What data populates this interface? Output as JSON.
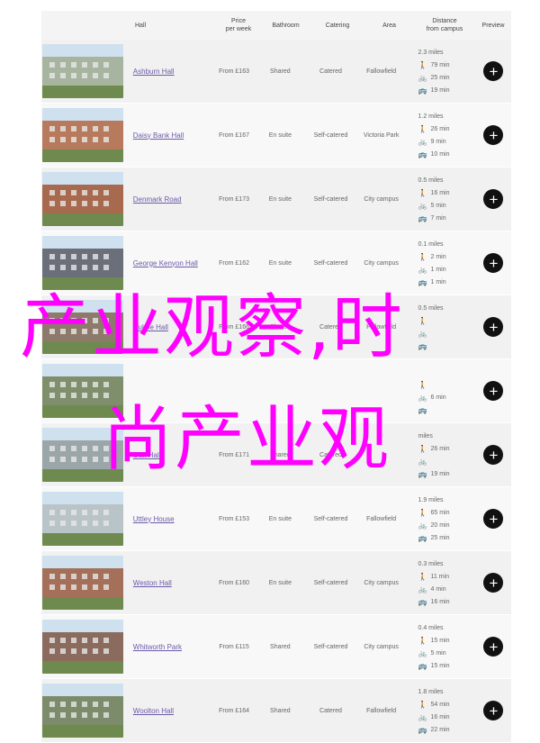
{
  "header": {
    "hall": "Hall",
    "price": "Price\nper week",
    "bathroom": "Bathroom",
    "catering": "Catering",
    "area": "Area",
    "distance": "Distance\nfrom campus",
    "preview": "Preview"
  },
  "rows": [
    {
      "name": "Ashburn Hall",
      "price": "From £163",
      "bath": "Shared",
      "cat": "Catered",
      "area": "Fallowfield",
      "miles": "2.3 miles",
      "walk": "79 min",
      "cycle": "25 min",
      "bus": "19 min",
      "thumb": "#a7b5a0"
    },
    {
      "name": "Daisy Bank Hall",
      "price": "From £167",
      "bath": "En suite",
      "cat": "Self-catered",
      "area": "Victoria Park",
      "miles": "1.2 miles",
      "walk": "26 min",
      "cycle": "9 min",
      "bus": "10 min",
      "thumb": "#b77a5c"
    },
    {
      "name": "Denmark Road",
      "price": "From £173",
      "bath": "En suite",
      "cat": "Self-catered",
      "area": "City campus",
      "miles": "0.5 miles",
      "walk": "16 min",
      "cycle": "5 min",
      "bus": "7 min",
      "thumb": "#a86a4e"
    },
    {
      "name": "George Kenyon Hall",
      "price": "From £162",
      "bath": "En suite",
      "cat": "Self-catered",
      "area": "City campus",
      "miles": "0.1 miles",
      "walk": "2 min",
      "cycle": "1 min",
      "bus": "1 min",
      "thumb": "#6a6f7a"
    },
    {
      "name": "Hulme Hall",
      "price": "From £166",
      "bath": "Shared",
      "cat": "Catered",
      "area": "Fallowfield",
      "miles": "0.5 miles",
      "walk": "",
      "cycle": "",
      "bus": "",
      "thumb": "#8e7a6a"
    },
    {
      "name": "",
      "price": "",
      "bath": "",
      "cat": "",
      "area": "",
      "miles": "",
      "walk": "",
      "cycle": "6 min",
      "bus": "",
      "thumb": "#7f8f6c"
    },
    {
      "name": "Oak Hall",
      "price": "From £171",
      "bath": "Shared",
      "cat": "Catered",
      "area": "",
      "miles": "miles",
      "walk": "26 min",
      "cycle": "",
      "bus": "19 min",
      "thumb": "#9aa6a8"
    },
    {
      "name": "Uttley House",
      "price": "From £153",
      "bath": "En suite",
      "cat": "Self-catered",
      "area": "Fallowfield",
      "miles": "1.9 miles",
      "walk": "65 min",
      "cycle": "20 min",
      "bus": "25 min",
      "thumb": "#b9c4c9"
    },
    {
      "name": "Weston Hall",
      "price": "From £160",
      "bath": "En suite",
      "cat": "Self-catered",
      "area": "City campus",
      "miles": "0.3 miles",
      "walk": "11 min",
      "cycle": "4 min",
      "bus": "16 min",
      "thumb": "#a4705a"
    },
    {
      "name": "Whitworth Park",
      "price": "From £115",
      "bath": "Shared",
      "cat": "Self-catered",
      "area": "City campus",
      "miles": "0.4 miles",
      "walk": "15 min",
      "cycle": "5 min",
      "bus": "15 min",
      "thumb": "#8a6b5e"
    },
    {
      "name": "Woolton Hall",
      "price": "From £164",
      "bath": "Shared",
      "cat": "Catered",
      "area": "Fallowfield",
      "miles": "1.8 miles",
      "walk": "54 min",
      "cycle": "16 min",
      "bus": "22 min",
      "thumb": "#7c8c6a"
    }
  ],
  "overlay": {
    "line1": "产业观察,时",
    "line2": "尚产业观"
  },
  "icons": {
    "walk": "walk-icon",
    "cycle": "bike-icon",
    "bus": "bus-icon",
    "preview": "plus-circle-icon"
  },
  "colors": {
    "link": "#6d5aa8",
    "overlay": "#ff00ff"
  }
}
